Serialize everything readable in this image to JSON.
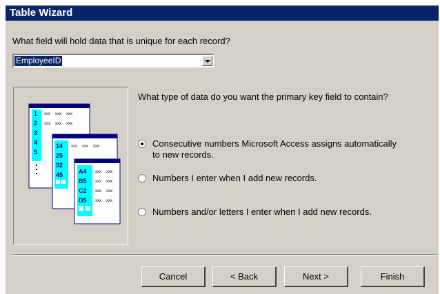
{
  "window": {
    "title": "Table Wizard"
  },
  "unique_field": {
    "prompt": "What field will hold data that is unique for each record?",
    "selected": "EmployeeID"
  },
  "primary_key": {
    "prompt": "What type of data do you want the primary key field to contain?",
    "options": [
      {
        "line1": "Consecutive numbers Microsoft Access assigns automatically",
        "line2": "to new records.",
        "selected": true
      },
      {
        "line1": "Numbers I enter when I add new records.",
        "line2": "",
        "selected": false
      },
      {
        "line1": "Numbers and/or letters I enter when I add new records.",
        "line2": "",
        "selected": false
      }
    ]
  },
  "illustration": {
    "table1_keys": [
      "1",
      "2",
      "3",
      "4",
      "5"
    ],
    "table2_keys": [
      "14",
      "25",
      "32",
      "45"
    ],
    "table3_keys": [
      "A4",
      "B5",
      "C2",
      "D5"
    ],
    "cell_text": "xxx"
  },
  "buttons": {
    "cancel": "Cancel",
    "back": "< Back",
    "next": "Next >",
    "finish": "Finish"
  },
  "colors": {
    "titlebar": "#0a246a",
    "dialog": "#d4d0c8",
    "key_cell": "#00ffff"
  }
}
